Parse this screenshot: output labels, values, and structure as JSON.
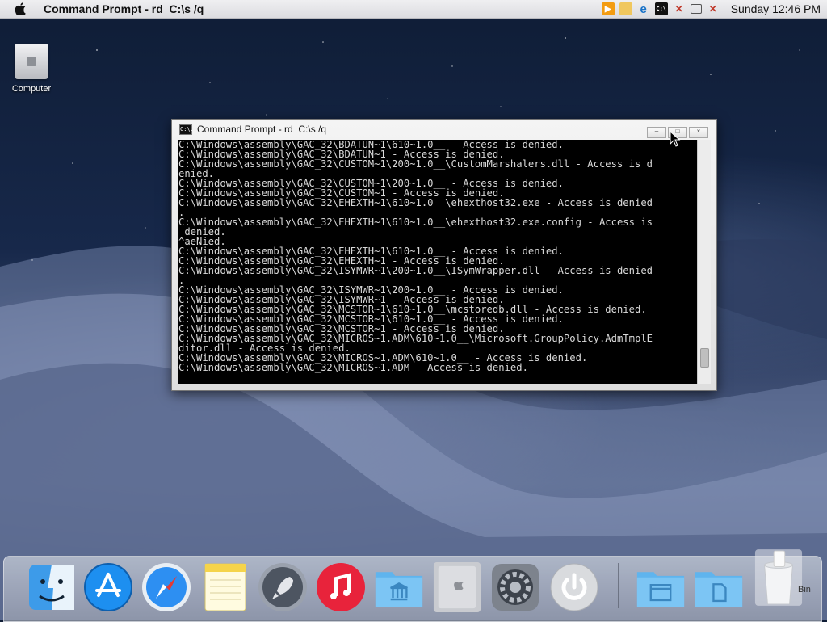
{
  "menubar": {
    "app_title": "Command Prompt - rd  C:\\s /q",
    "clock": "Sunday 12:46 PM",
    "tray_icons": [
      "media-player-icon",
      "folder-icon",
      "internet-explorer-icon",
      "cmd-icon",
      "network-icon",
      "display-icon",
      "volume-muted-icon"
    ]
  },
  "desktop": {
    "computer_label": "Computer"
  },
  "cmd_window": {
    "title": "Command Prompt - rd  C:\\s /q",
    "icon_text": "C:\\.",
    "min_label": "–",
    "max_label": "□",
    "close_label": "×",
    "lines": [
      "C:\\Windows\\assembly\\GAC_32\\BDATUN~1\\610~1.0__ - Access is denied.",
      "C:\\Windows\\assembly\\GAC_32\\BDATUN~1 - Access is denied.",
      "C:\\Windows\\assembly\\GAC_32\\CUSTOM~1\\200~1.0__\\CustomMarshalers.dll - Access is d",
      "enied.",
      "C:\\Windows\\assembly\\GAC_32\\CUSTOM~1\\200~1.0__ - Access is denied.",
      "C:\\Windows\\assembly\\GAC_32\\CUSTOM~1 - Access is denied.",
      "C:\\Windows\\assembly\\GAC_32\\EHEXTH~1\\610~1.0__\\ehexthost32.exe - Access is denied",
      ".",
      "C:\\Windows\\assembly\\GAC_32\\EHEXTH~1\\610~1.0__\\ehexthost32.exe.config - Access is",
      " denied.",
      "^aeNied.",
      "C:\\Windows\\assembly\\GAC_32\\EHEXTH~1\\610~1.0__ - Access is denied.",
      "C:\\Windows\\assembly\\GAC_32\\EHEXTH~1 - Access is denied.",
      "C:\\Windows\\assembly\\GAC_32\\ISYMWR~1\\200~1.0__\\ISymWrapper.dll - Access is denied",
      ".",
      "C:\\Windows\\assembly\\GAC_32\\ISYMWR~1\\200~1.0__ - Access is denied.",
      "C:\\Windows\\assembly\\GAC_32\\ISYMWR~1 - Access is denied.",
      "C:\\Windows\\assembly\\GAC_32\\MCSTOR~1\\610~1.0__\\mcstoredb.dll - Access is denied.",
      "C:\\Windows\\assembly\\GAC_32\\MCSTOR~1\\610~1.0__ - Access is denied.",
      "C:\\Windows\\assembly\\GAC_32\\MCSTOR~1 - Access is denied.",
      "C:\\Windows\\assembly\\GAC_32\\MICROS~1.ADM\\610~1.0__\\Microsoft.GroupPolicy.AdmTmplE",
      "ditor.dll - Access is denied.",
      "C:\\Windows\\assembly\\GAC_32\\MICROS~1.ADM\\610~1.0__ - Access is denied.",
      "C:\\Windows\\assembly\\GAC_32\\MICROS~1.ADM - Access is denied."
    ]
  },
  "dock": {
    "items": [
      "finder-icon",
      "app-store-icon",
      "safari-icon",
      "notes-icon",
      "launchpad-icon",
      "itunes-icon",
      "applications-folder-icon",
      "computer-icon",
      "system-preferences-icon",
      "power-icon",
      "documents-folder-icon",
      "downloads-folder-icon",
      "recycle-bin-icon"
    ],
    "bin_label": "Bin"
  },
  "colors": {
    "console_bg": "#000000",
    "console_text": "#d9d9d9",
    "menubar_bg": "#e6e6e9"
  }
}
